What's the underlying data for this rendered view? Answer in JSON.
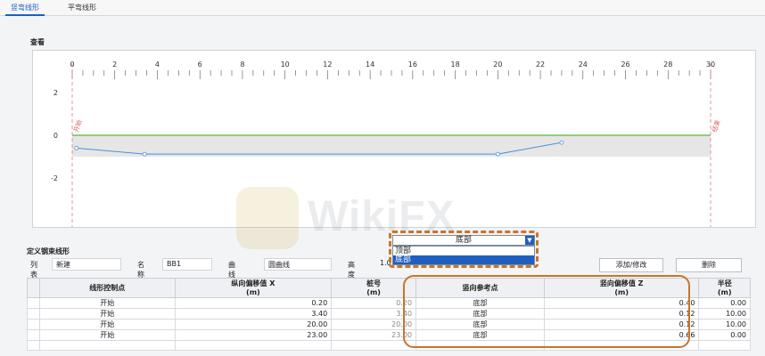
{
  "tabs": [
    "竖弯线形",
    "平弯线形"
  ],
  "view_label": "查看",
  "define_label": "定义钢束线形",
  "chart_data": {
    "type": "line",
    "x_ticks": [
      0,
      2,
      4,
      6,
      8,
      10,
      12,
      14,
      16,
      18,
      20,
      22,
      24,
      26,
      28,
      30
    ],
    "y_ticks": [
      2,
      0,
      -2
    ],
    "xlim": [
      0,
      30
    ],
    "ylim": [
      -2.5,
      2.5
    ],
    "start_label": "开始",
    "end_label": "结束",
    "series": [
      {
        "x": [
          0.2,
          3.4,
          20.0,
          23.0
        ],
        "y": [
          -0.6,
          -0.88,
          -0.88,
          -0.34
        ]
      }
    ],
    "reference_line_y": 0
  },
  "form": {
    "list_label": "列表",
    "list_value": "新建",
    "name_label": "名称",
    "name_value": "BB1",
    "curve_type_label": "曲线类型",
    "curve_type_value": "圆曲线",
    "height_label": "高度",
    "height_value": "1.0",
    "add_button": "添加/修改",
    "delete_button": "删除"
  },
  "dropdown": {
    "selected": "底部",
    "options": [
      "顶部",
      "底部"
    ]
  },
  "table": {
    "headers": [
      {
        "title": "线形控制点",
        "unit": ""
      },
      {
        "title": "纵向偏移值 X",
        "unit": "(m)"
      },
      {
        "title": "桩号",
        "unit": "(m)"
      },
      {
        "title": "竖向参考点",
        "unit": ""
      },
      {
        "title": "竖向偏移值 Z",
        "unit": "(m)"
      },
      {
        "title": "半径",
        "unit": "(m)"
      }
    ],
    "rows": [
      [
        "开始",
        "0.20",
        "0.20",
        "底部",
        "0.40",
        "0.00"
      ],
      [
        "开始",
        "3.40",
        "3.40",
        "底部",
        "0.12",
        "10.00"
      ],
      [
        "开始",
        "20.00",
        "20.00",
        "底部",
        "0.12",
        "10.00"
      ],
      [
        "开始",
        "23.00",
        "23.00",
        "底部",
        "0.66",
        "0.00"
      ]
    ]
  },
  "watermark": "WikiFX"
}
